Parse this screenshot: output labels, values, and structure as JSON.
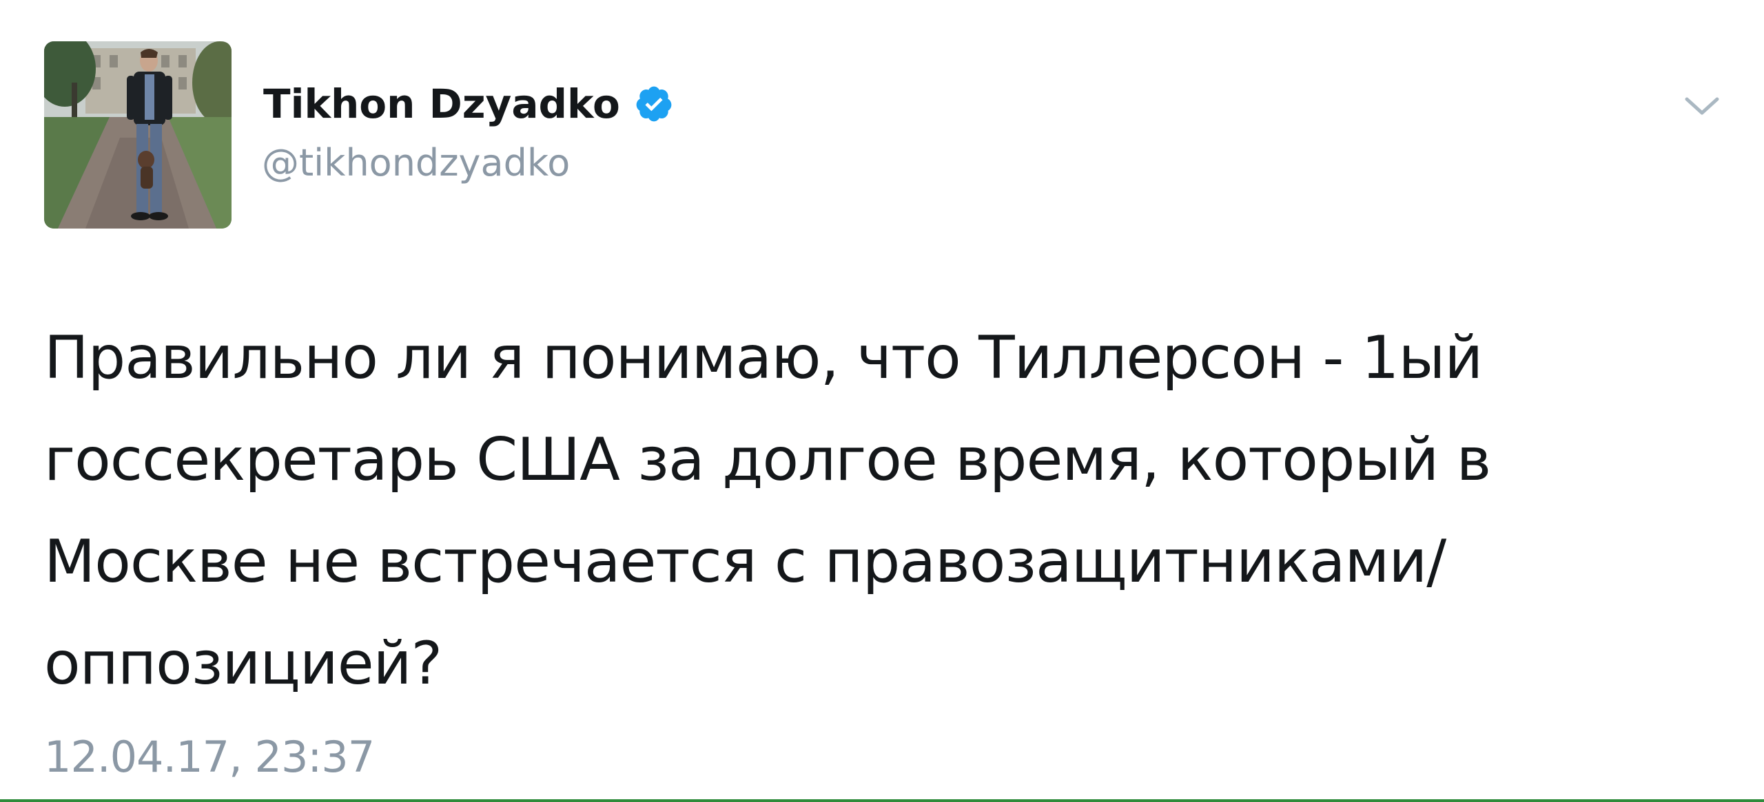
{
  "tweet": {
    "author": {
      "display_name": "Tikhon Dzyadko",
      "handle": "@tikhondzyadko",
      "verified": true,
      "avatar_icon": "profile-photo",
      "verified_icon": "verified-badge-icon"
    },
    "text_lines": [
      "Правильно ли я понимаю, что Тиллерсон - 1ый",
      "госсекретарь США за долгое время, который в",
      "Москве не встречается с правозащитниками/",
      "оппозицией?"
    ],
    "timestamp": "12.04.17, 23:37",
    "menu_icon": "chevron-down-icon"
  },
  "colors": {
    "text": "#14171a",
    "secondary_text": "#8b98a5",
    "verified_blue": "#1da1f2",
    "background": "#ffffff",
    "bottom_edge": "#2e8b3a"
  }
}
